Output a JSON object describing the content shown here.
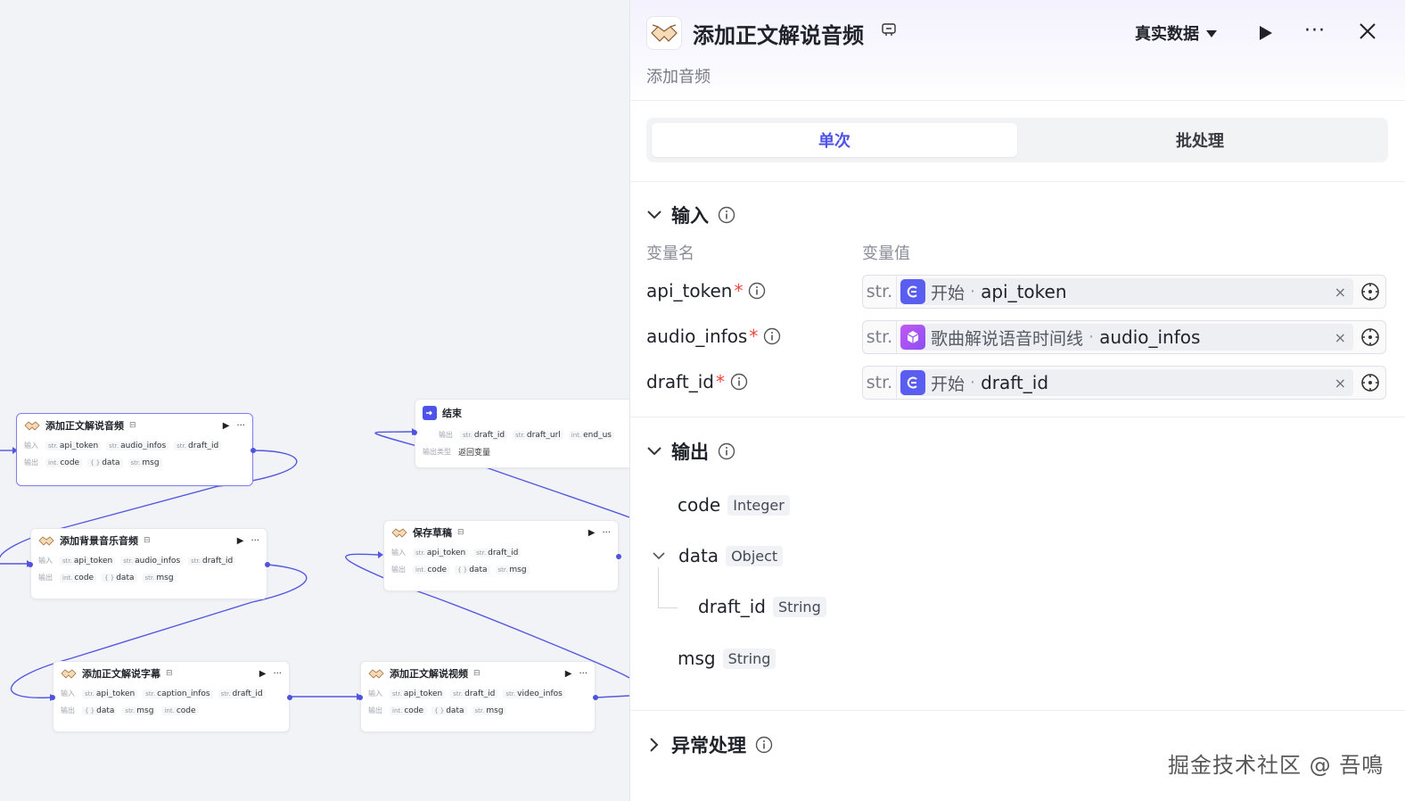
{
  "canvas": {
    "nodes": [
      {
        "title": "添加正文解说音频",
        "ext_icon": "⊟",
        "inputs_label": "输入",
        "outputs_label": "输出",
        "inputs": [
          {
            "t": "str.",
            "n": "api_token"
          },
          {
            "t": "str.",
            "n": "audio_infos"
          },
          {
            "t": "str.",
            "n": "draft_id"
          }
        ],
        "outputs": [
          {
            "t": "int.",
            "n": "code"
          },
          {
            "t": "{ }",
            "n": "data"
          },
          {
            "t": "str.",
            "n": "msg"
          }
        ]
      },
      {
        "title": "结束",
        "inputs_label": "输出",
        "outputs_label": "输出类型",
        "inputs": [
          {
            "t": "str.",
            "n": "draft_id"
          },
          {
            "t": "str.",
            "n": "draft_url"
          },
          {
            "t": "int.",
            "n": "end_us"
          }
        ],
        "output_type": "返回变量"
      },
      {
        "title": "添加背景音乐音频",
        "ext_icon": "⊟",
        "inputs_label": "输入",
        "outputs_label": "输出",
        "inputs": [
          {
            "t": "str.",
            "n": "api_token"
          },
          {
            "t": "str.",
            "n": "audio_infos"
          },
          {
            "t": "str.",
            "n": "draft_id"
          }
        ],
        "outputs": [
          {
            "t": "int.",
            "n": "code"
          },
          {
            "t": "{ }",
            "n": "data"
          },
          {
            "t": "str.",
            "n": "msg"
          }
        ]
      },
      {
        "title": "保存草稿",
        "ext_icon": "⊟",
        "inputs_label": "输入",
        "outputs_label": "输出",
        "inputs": [
          {
            "t": "str.",
            "n": "api_token"
          },
          {
            "t": "str.",
            "n": "draft_id"
          }
        ],
        "outputs": [
          {
            "t": "int.",
            "n": "code"
          },
          {
            "t": "{ }",
            "n": "data"
          },
          {
            "t": "str.",
            "n": "msg"
          }
        ]
      },
      {
        "title": "添加正文解说字幕",
        "ext_icon": "⊟",
        "inputs_label": "输入",
        "outputs_label": "输出",
        "inputs": [
          {
            "t": "str.",
            "n": "api_token"
          },
          {
            "t": "str.",
            "n": "caption_infos"
          },
          {
            "t": "str.",
            "n": "draft_id"
          }
        ],
        "outputs": [
          {
            "t": "{ }",
            "n": "data"
          },
          {
            "t": "str.",
            "n": "msg"
          },
          {
            "t": "int.",
            "n": "code"
          }
        ]
      },
      {
        "title": "添加正文解说视频",
        "ext_icon": "⊟",
        "inputs_label": "输入",
        "outputs_label": "输出",
        "inputs": [
          {
            "t": "str.",
            "n": "api_token"
          },
          {
            "t": "str.",
            "n": "draft_id"
          },
          {
            "t": "str.",
            "n": "video_infos"
          }
        ],
        "outputs": [
          {
            "t": "int.",
            "n": "code"
          },
          {
            "t": "{ }",
            "n": "data"
          },
          {
            "t": "str.",
            "n": "msg"
          }
        ]
      }
    ]
  },
  "panel": {
    "title": "添加正文解说音频",
    "subtitle": "添加音频",
    "mode": "真实数据",
    "tabs": [
      {
        "label": "单次",
        "active": true
      },
      {
        "label": "批处理",
        "active": false
      }
    ],
    "input": {
      "heading": "输入",
      "col_name": "变量名",
      "col_value": "变量值",
      "vars": [
        {
          "name": "api_token",
          "type": "str.",
          "ref_node": "开始",
          "ref_var": "api_token",
          "ref_icon": "start-node-icon"
        },
        {
          "name": "audio_infos",
          "type": "str.",
          "ref_node": "歌曲解说语音时间线",
          "ref_var": "audio_infos",
          "ref_icon": "cube-icon"
        },
        {
          "name": "draft_id",
          "type": "str.",
          "ref_node": "开始",
          "ref_var": "draft_id",
          "ref_icon": "start-node-icon"
        }
      ],
      "required_mark": "*",
      "clear": "×"
    },
    "output": {
      "heading": "输出",
      "fields": [
        {
          "name": "code",
          "type": "Integer"
        },
        {
          "name": "data",
          "type": "Object"
        },
        {
          "name": "draft_id",
          "type": "String"
        },
        {
          "name": "msg",
          "type": "String"
        }
      ]
    },
    "exception": {
      "heading": "异常处理"
    }
  },
  "watermark": "掘金技术社区 @ 吾鳴",
  "colors": {
    "accent": "#4d53e8",
    "required": "#f0463c",
    "edge": "#4e52dc"
  }
}
